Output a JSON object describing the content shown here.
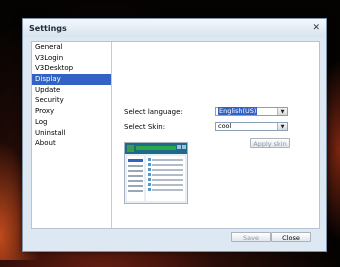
{
  "window": {
    "title": "Settings",
    "close_glyph": "✕"
  },
  "sidebar": {
    "items": [
      {
        "label": "General",
        "active": false
      },
      {
        "label": "V3Login",
        "active": false
      },
      {
        "label": "V3Desktop",
        "active": false
      },
      {
        "label": "Display",
        "active": true
      },
      {
        "label": "Update",
        "active": false
      },
      {
        "label": "Security",
        "active": false
      },
      {
        "label": "Proxy",
        "active": false
      },
      {
        "label": "Log",
        "active": false
      },
      {
        "label": "Uninstall",
        "active": false
      },
      {
        "label": "About",
        "active": false
      }
    ]
  },
  "display": {
    "language_label": "Select language:",
    "language_value": "English(US)",
    "skin_label": "Select Skin:",
    "skin_value": "cool",
    "apply_label": "Apply skin"
  },
  "footer": {
    "save_label": "Save",
    "close_label": "Close"
  },
  "colors": {
    "selection": "#3162c4",
    "window_bg": "#dde8f2"
  }
}
